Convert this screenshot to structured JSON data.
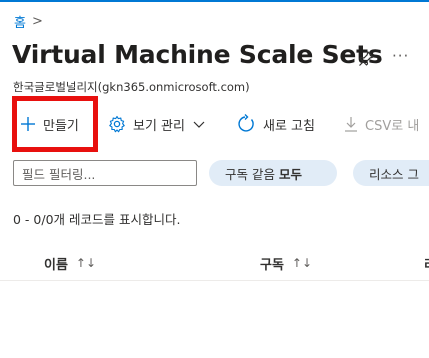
{
  "breadcrumb": {
    "home": "홈",
    "separator": ">"
  },
  "header": {
    "title": "Virtual Machine Scale Sets",
    "subtitle": "한국글로벌널리지(gkn365.onmicrosoft.com)",
    "pin_icon": "pin-icon",
    "more_label": "···"
  },
  "toolbar": {
    "create_label": "만들기",
    "view_label": "보기 관리",
    "refresh_label": "새로 고침",
    "csv_label": "CSV로 내"
  },
  "filters": {
    "search_placeholder": "필드 필터링...",
    "subscription_prefix": "구독 같음",
    "subscription_value": "모두",
    "resource_label": "리소스 그"
  },
  "records_text": "0 - 0/0개 레코드를 표시합니다.",
  "table": {
    "columns": [
      {
        "label": "이름",
        "sort": "↑↓"
      },
      {
        "label": "구독",
        "sort": "↑↓"
      },
      {
        "label": "리"
      }
    ]
  },
  "colors": {
    "accent": "#0078d4",
    "highlight": "#e8100e",
    "pill_bg": "#e1ecf7"
  }
}
